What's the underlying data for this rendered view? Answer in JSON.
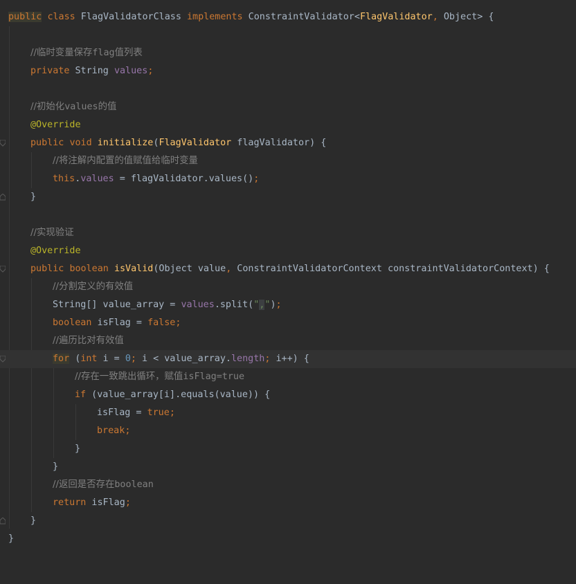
{
  "editor": {
    "lines": [
      {
        "text": "public class FlagValidatorClass implements ConstraintValidator<FlagValidator, Object> {"
      },
      {
        "text": ""
      },
      {
        "text": "    //临时变量保存flag值列表"
      },
      {
        "text": "    private String values;"
      },
      {
        "text": ""
      },
      {
        "text": "    //初始化values的值"
      },
      {
        "text": "    @Override"
      },
      {
        "text": "    public void initialize(FlagValidator flagValidator) {"
      },
      {
        "text": "        //将注解内配置的值赋值给临时变量"
      },
      {
        "text": "        this.values = flagValidator.values();"
      },
      {
        "text": "    }"
      },
      {
        "text": ""
      },
      {
        "text": "    //实现验证"
      },
      {
        "text": "    @Override"
      },
      {
        "text": "    public boolean isValid(Object value, ConstraintValidatorContext constraintValidatorContext) {"
      },
      {
        "text": "        //分割定义的有效值"
      },
      {
        "text": "        String[] value_array = values.split(\",\");"
      },
      {
        "text": "        boolean isFlag = false;"
      },
      {
        "text": "        //遍历比对有效值"
      },
      {
        "text": "        for (int i = 0; i < value_array.length; i++) {"
      },
      {
        "text": "            //存在一致跳出循环，赋值isFlag=true"
      },
      {
        "text": "            if (value_array[i].equals(value)) {"
      },
      {
        "text": "                isFlag = true;"
      },
      {
        "text": "                break;"
      },
      {
        "text": "            }"
      },
      {
        "text": "        }"
      },
      {
        "text": "        //返回是否存在boolean"
      },
      {
        "text": "        return isFlag;"
      },
      {
        "text": "    }"
      },
      {
        "text": "}"
      }
    ],
    "colors": {
      "background": "#2b2b2b",
      "keyword": "#cc7832",
      "field": "#9876aa",
      "method": "#ffc66d",
      "annotation": "#bbb529",
      "comment": "#808080",
      "number": "#6897bb",
      "string": "#6a8759",
      "text": "#a9b7c6"
    }
  }
}
